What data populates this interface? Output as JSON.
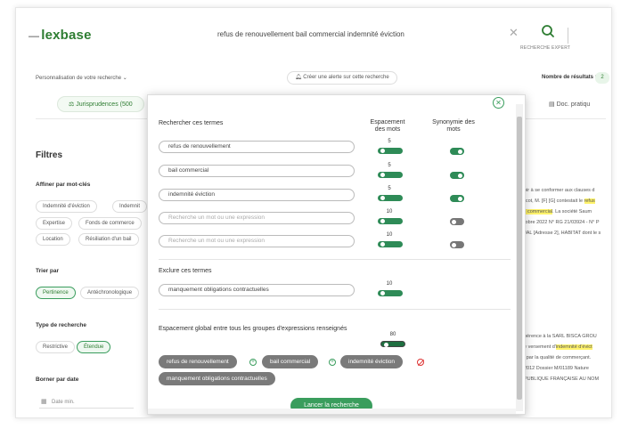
{
  "header": {
    "logo_prefix": "—",
    "logo_text": "lexbase",
    "search_query": "refus de renouvellement bail commercial indemnité éviction",
    "search_button_caption": "RECHERCHE EXPERT"
  },
  "subbar": {
    "personalize_label": "Personnalisation de votre recherche",
    "alert_label": "Créer une alerte sur cette recherche",
    "results_label": "Nombre de résultats :",
    "results_value": "2"
  },
  "tabs": {
    "jurisprudences": "Jurisprudences (500",
    "doc_pratique": "Doc. pratiqu"
  },
  "filters": {
    "title": "Filtres",
    "keywords_title": "Affiner par mot-clés",
    "keywords": [
      "Indemnité d'éviction",
      "Indemnit",
      "Expertise",
      "Fonds de commerce",
      "Location",
      "Résiliation d'un bail"
    ],
    "sort_title": "Trier par",
    "sort_options": [
      "Pertinence",
      "Antéchronologique"
    ],
    "type_title": "Type de recherche",
    "type_options": [
      "Restrictive",
      "Étendue"
    ],
    "date_title": "Borner par date",
    "date_min_placeholder": "Date min."
  },
  "background_snippets": [
    {
      "before": "oir à se conformer aux clauses d",
      "hl": "",
      "after": ""
    },
    {
      "before": "rcot, M. [F] [G] contestait le ",
      "hl": "refus",
      "after": ""
    },
    {
      "before": "",
      "hl": "il commercial",
      "after": ". La société Saum"
    },
    {
      "before": "tobre 2022 N° RG 21/03924 - N° P",
      "hl": "",
      "after": ""
    },
    {
      "before": "JAL [Adresse 2], HABITAT dont le s",
      "hl": "",
      "after": ""
    },
    {
      "before": "pérence à la SARL BISCA GROU",
      "hl": "",
      "after": ""
    },
    {
      "before": "e versement d'",
      "hl": "indemnité d'évict",
      "after": ""
    },
    {
      "before": "l par la qualité de commerçant.",
      "hl": "",
      "after": ""
    },
    {
      "before": "2012 Dossier M/01189 Nature",
      "hl": "",
      "after": ""
    },
    {
      "before": "PUBLIQUE FRANÇAISE AU NOM",
      "hl": "",
      "after": ""
    }
  ],
  "modal": {
    "search_title": "Rechercher ces termes",
    "spacing_header": "Espacement des mots",
    "synonym_header": "Synonymie des mots",
    "terms": [
      {
        "value": "refus de renouvellement",
        "spacing": "5",
        "synonyms": true
      },
      {
        "value": "bail commercial",
        "spacing": "5",
        "synonyms": true
      },
      {
        "value": "indemnité éviction",
        "spacing": "5",
        "synonyms": true
      },
      {
        "value": "",
        "placeholder": "Recherche un mot ou une expression",
        "spacing": "10",
        "synonyms": false
      },
      {
        "value": "",
        "placeholder": "Recherche un mot ou une expression",
        "spacing": "10",
        "synonyms": false
      }
    ],
    "exclude_title": "Exclure ces termes",
    "exclude_term": {
      "value": "manquement obligations contractuelles",
      "spacing": "10"
    },
    "global_title": "Espacement global entre tous les groupes d'expressions renseignés",
    "global_spacing": "80",
    "summary_pills": [
      "refus de renouvellement",
      "bail commercial",
      "indemnité éviction",
      "manquement obligations contractuelles"
    ],
    "launch_label": "Lancer la recherche"
  }
}
